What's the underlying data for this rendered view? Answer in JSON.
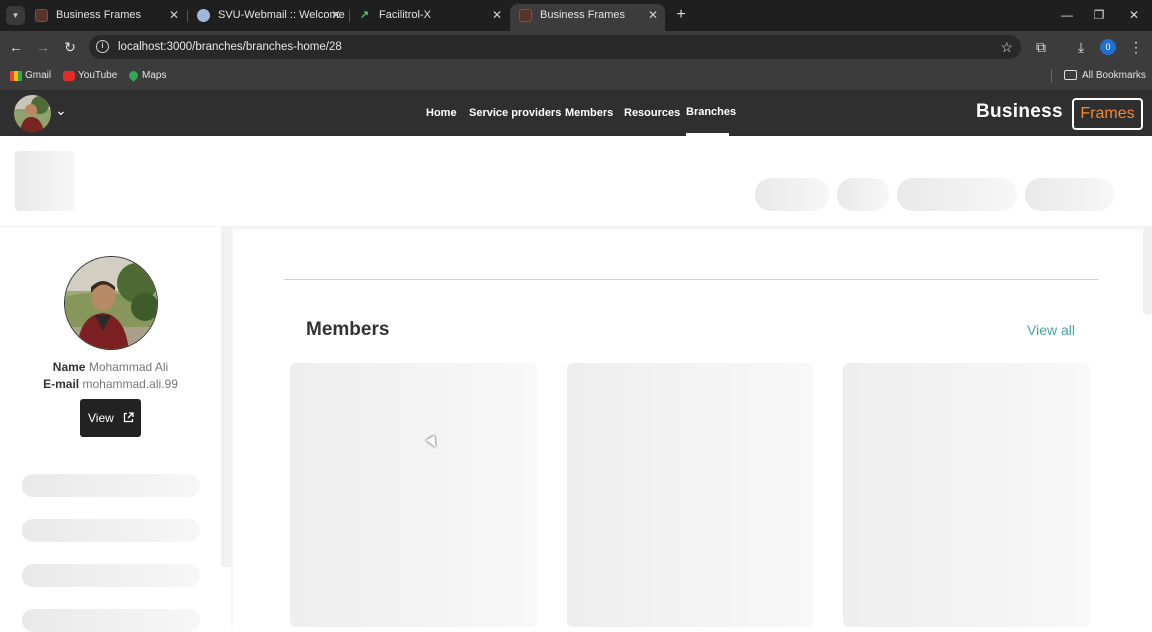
{
  "browser": {
    "tabs": [
      {
        "title": "Business Frames",
        "active": false
      },
      {
        "title": "SVU-Webmail :: Welcome",
        "active": false
      },
      {
        "title": "Facilitrol-X",
        "active": false
      },
      {
        "title": "Business Frames",
        "active": true
      }
    ],
    "url": "localhost:3000/branches/branches-home/28",
    "profile_initial": "0",
    "bookmarks": [
      "Gmail",
      "YouTube",
      "Maps"
    ],
    "all_bookmarks_label": "All Bookmarks"
  },
  "app": {
    "nav_links": [
      "Home",
      "Service providers",
      "Members",
      "Resources",
      "Branches"
    ],
    "active_nav": "Branches",
    "brand_text": "Business",
    "brand_box_text": "Frames",
    "brand_box_color": "#f08a2f"
  },
  "profile": {
    "name_label": "Name",
    "name_value": "Mohammad Ali",
    "email_label": "E-mail",
    "email_value": "mohammad.ali.99",
    "view_button": "View"
  },
  "main": {
    "section_title": "Members",
    "view_all": "View all",
    "accent_color": "#4aa3a5"
  }
}
